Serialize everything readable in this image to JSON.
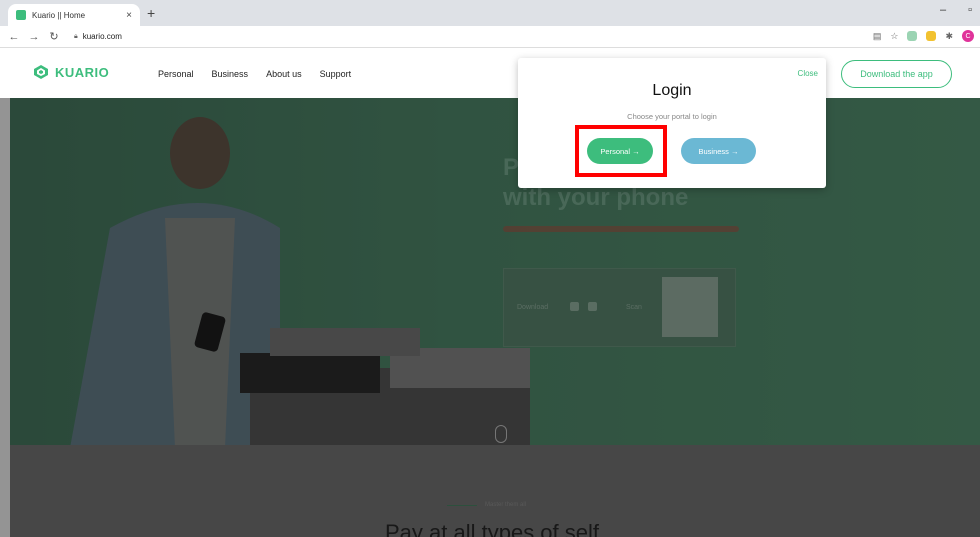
{
  "browser": {
    "tab_title": "Kuario || Home",
    "tab_close": "×",
    "new_tab": "+",
    "url": "kuario.com",
    "window_controls": [
      "–",
      "▫"
    ]
  },
  "site": {
    "brand": "KUARIO",
    "nav": [
      "Personal",
      "Business",
      "About us",
      "Support"
    ],
    "download_button": "Download the app",
    "hero": {
      "headline_line1": "P",
      "headline_line2": "with your phone",
      "download_label": "Download",
      "scan_label": "Scan"
    },
    "below": {
      "eyebrow": "Master them all",
      "heading": "Pay at all types of self"
    }
  },
  "modal": {
    "close": "Close",
    "title": "Login",
    "subtitle": "Choose your portal to login",
    "personal_button": "Personal  →",
    "business_button": "Business  →"
  },
  "colors": {
    "brand_green": "#3dbd7d",
    "business_blue": "#6bb8d4",
    "highlight_red": "#ff0000"
  }
}
